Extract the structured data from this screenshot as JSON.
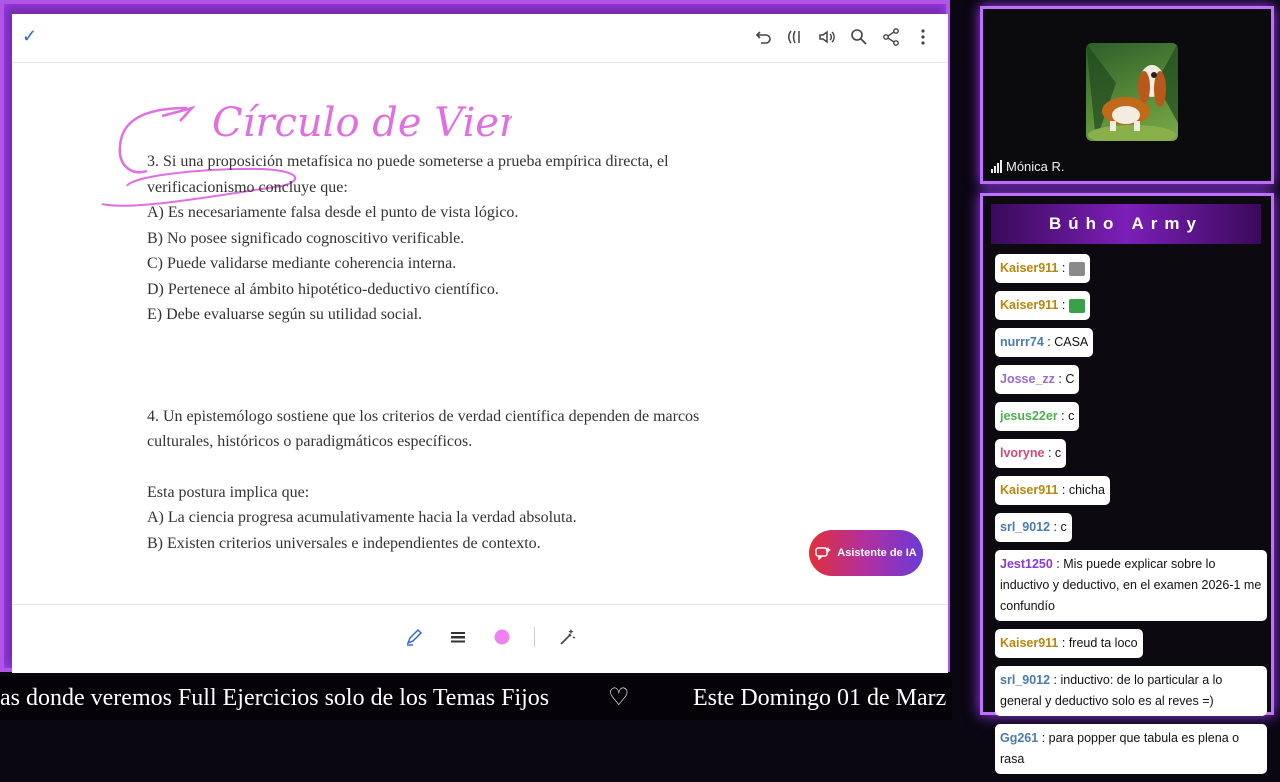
{
  "document": {
    "check_icon": "check-icon",
    "toolbar_icons": [
      "undo-icon",
      "read-aloud-icon",
      "volume-icon",
      "search-icon",
      "share-icon",
      "more-icon"
    ],
    "handwriting": "Círculo de Viena",
    "q3": {
      "line1": "3. Si una proposición metafísica no puede someterse a prueba empírica directa, el",
      "line2": "verificacionismo concluye que:",
      "a": "A) Es necesariamente falsa desde el punto de vista lógico.",
      "b": "B) No posee significado cognoscitivo verificable.",
      "c": "C) Puede validarse mediante coherencia interna.",
      "d": "D) Pertenece al ámbito hipotético-deductivo científico.",
      "e": "E) Debe evaluarse según su utilidad social."
    },
    "q4": {
      "line1": "4. Un epistemólogo sostiene que los criterios de verdad científica dependen de marcos",
      "line2": "culturales, históricos o paradigmáticos específicos.",
      "lead": "Esta postura implica que:",
      "a": "A) La ciencia progresa acumulativamente hacia la verdad absoluta.",
      "b": "B) Existen criterios universales e independientes de contexto."
    },
    "ai_button": "Asistente de IA",
    "bottom_tools": [
      "pen-icon",
      "lines-icon",
      "color-dot-icon",
      "magic-icon"
    ],
    "pen_color": "#ee82ee"
  },
  "ticker": {
    "left": "as donde veremos Full Ejercicios solo de los Temas Fijos",
    "heart": "♡",
    "right": "Este Domingo 01 de Marz"
  },
  "webcam": {
    "name": "Mónica R."
  },
  "chat": {
    "title": "Búho Army",
    "messages": [
      {
        "user": "Kaiser911",
        "color": "#b8860b",
        "text": "",
        "emote": "cat-emote"
      },
      {
        "user": "Kaiser911",
        "color": "#b8860b",
        "text": "",
        "emote": "frog-emote"
      },
      {
        "user": "nurrr74",
        "color": "#4a7ab0",
        "text": "CASA"
      },
      {
        "user": "Josse_zz",
        "color": "#9a6ad0",
        "text": "C"
      },
      {
        "user": "jesus22er",
        "color": "#4caf50",
        "text": "c"
      },
      {
        "user": "lvoryne",
        "color": "#d04a7a",
        "text": "c"
      },
      {
        "user": "Kaiser911",
        "color": "#b8860b",
        "text": "chicha"
      },
      {
        "user": "srl_9012",
        "color": "#4a7ab0",
        "text": "c"
      },
      {
        "user": "Jest1250",
        "color": "#8a3ad0",
        "text": "Mis puede explicar sobre lo inductivo y deductivo, en el examen 2026-1 me confundío"
      },
      {
        "user": "Kaiser911",
        "color": "#b8860b",
        "text": "freud ta loco"
      },
      {
        "user": "srl_9012",
        "color": "#4a7ab0",
        "text": "inductivo: de lo particular a lo general y deductivo solo es al reves =)"
      },
      {
        "user": "Gg261",
        "color": "#4a7ab0",
        "text": "para popper que tabula es plena o rasa"
      }
    ]
  },
  "colors": {
    "frame": "#c070ff",
    "ai_gradient_start": "#e0303a",
    "ai_gradient_end": "#6a3ad8"
  }
}
